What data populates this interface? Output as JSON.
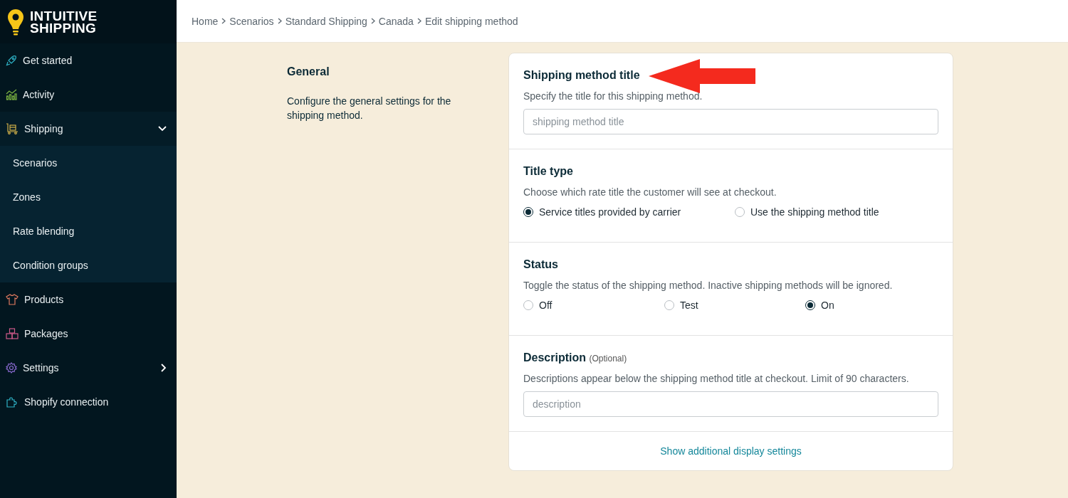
{
  "logo": {
    "line_1": "INTUITIVE",
    "line_2": "SHIPPING"
  },
  "sidebar": {
    "items": [
      {
        "label": "Get started"
      },
      {
        "label": "Activity"
      },
      {
        "label": "Shipping",
        "expanded": true,
        "children": [
          {
            "label": "Scenarios"
          },
          {
            "label": "Zones"
          },
          {
            "label": "Rate blending"
          },
          {
            "label": "Condition groups"
          }
        ]
      },
      {
        "label": "Products"
      },
      {
        "label": "Packages"
      },
      {
        "label": "Settings",
        "expanded": false
      },
      {
        "label": "Shopify connection"
      }
    ]
  },
  "breadcrumb": [
    "Home",
    "Scenarios",
    "Standard Shipping",
    "Canada",
    "Edit shipping method"
  ],
  "section": {
    "title": "General",
    "description": "Configure the general settings for the shipping method."
  },
  "card": {
    "sections": [
      {
        "kind": "input",
        "title": "Shipping method title",
        "hint": "Specify the title for this shipping method.",
        "placeholder": "shipping method title",
        "annotated": true
      },
      {
        "kind": "radio",
        "title": "Title type",
        "hint": "Choose which rate title the customer will see at checkout.",
        "options": [
          {
            "label": "Service titles provided by carrier",
            "selected": true
          },
          {
            "label": "Use the shipping method title",
            "selected": false
          }
        ]
      },
      {
        "kind": "radio",
        "title": "Status",
        "hint": "Toggle the status of the shipping method. Inactive shipping methods will be ignored.",
        "options": [
          {
            "label": "Off",
            "selected": false
          },
          {
            "label": "Test",
            "selected": false
          },
          {
            "label": "On",
            "selected": true
          }
        ]
      },
      {
        "kind": "input",
        "title": "Description",
        "optional": "(Optional)",
        "hint": "Descriptions appear below the shipping method title at checkout. Limit of 90 characters.",
        "placeholder": "description",
        "annotated": false
      }
    ],
    "link": "Show additional display settings"
  }
}
